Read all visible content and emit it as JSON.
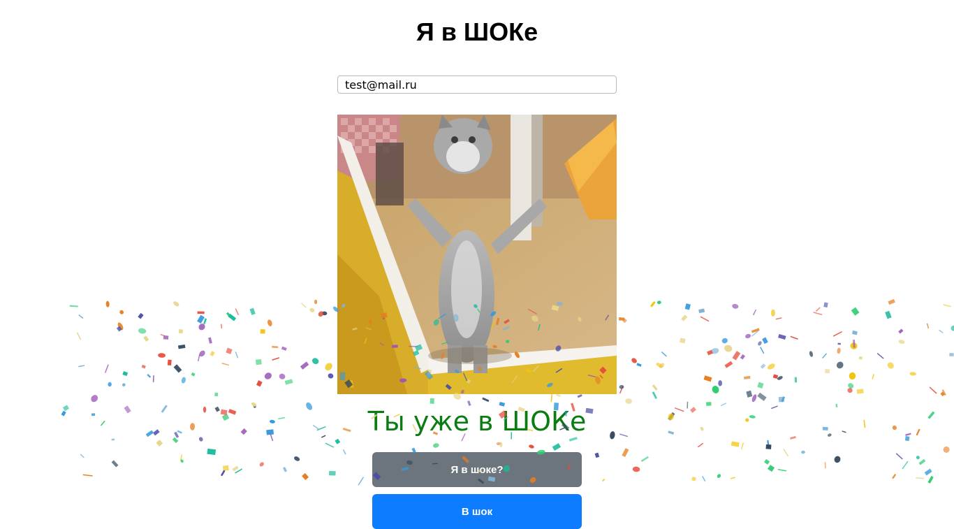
{
  "header": {
    "title": "Я в ШОКе"
  },
  "form": {
    "email_value": "test@mail.ru"
  },
  "image": {
    "alt": "cat"
  },
  "status": {
    "message": "Ты уже в ШОКе",
    "color": "#0a7d12"
  },
  "buttons": {
    "shock_question_label": "Я в шоке?",
    "shock_label": "В шок",
    "shock_question_color": "#6c757d",
    "shock_color": "#0d7cff"
  },
  "confetti": {
    "colors": [
      "#e74c3c",
      "#3498db",
      "#2ecc71",
      "#9b59b6",
      "#e67e22",
      "#f1c40f",
      "#1abc9c",
      "#34495e",
      "#e8d48a",
      "#4a4aa8",
      "#7fb3d5"
    ]
  }
}
